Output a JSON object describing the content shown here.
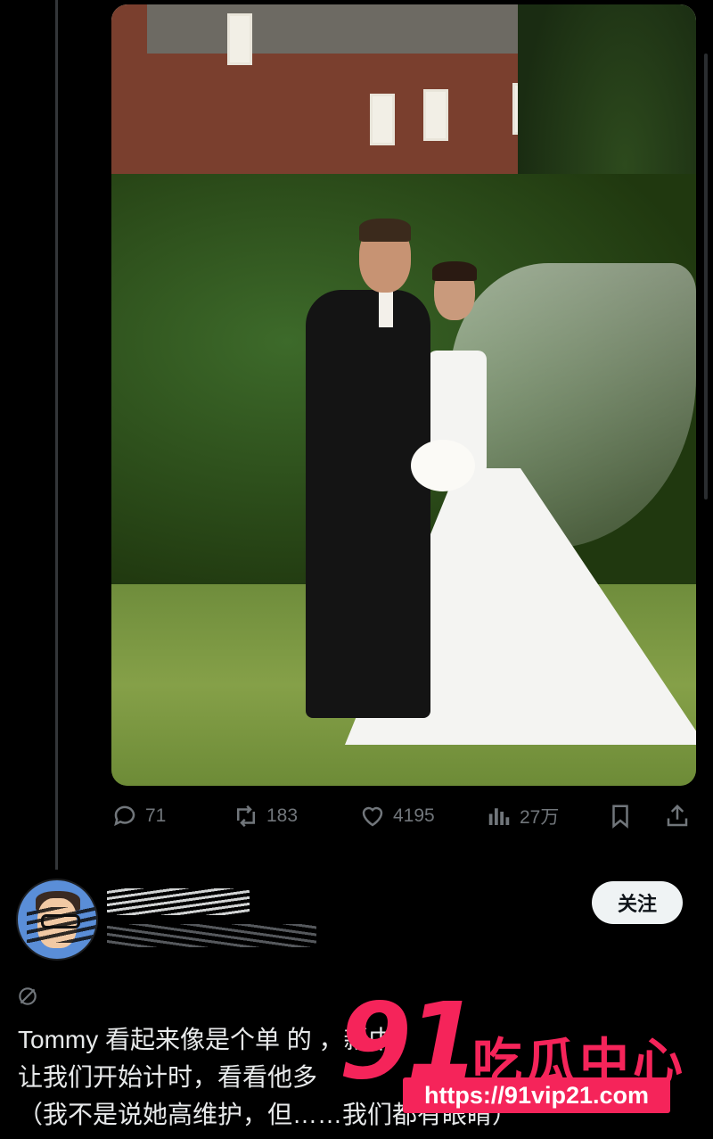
{
  "post": {
    "stats": {
      "replies": "71",
      "reposts": "183",
      "likes": "4195",
      "views": "27万"
    }
  },
  "reply": {
    "follow_label": "关注",
    "text_lines": [
      "Tommy 看起来像是个单    的     ，新中",
      "让我们开始计时，看看他多",
      "（我不是说她高维护，但……我们都有眼睛）"
    ]
  },
  "watermark": {
    "number": "91",
    "brand": "吃瓜中心",
    "url": "https://91vip21.com"
  },
  "colors": {
    "background": "#000000",
    "text": "#e7e9ea",
    "muted": "#71767b",
    "watermark": "#f5245a"
  },
  "icons": [
    "reply-icon",
    "repost-icon",
    "like-icon",
    "views-icon",
    "bookmark-icon",
    "share-icon",
    "translate-icon"
  ]
}
